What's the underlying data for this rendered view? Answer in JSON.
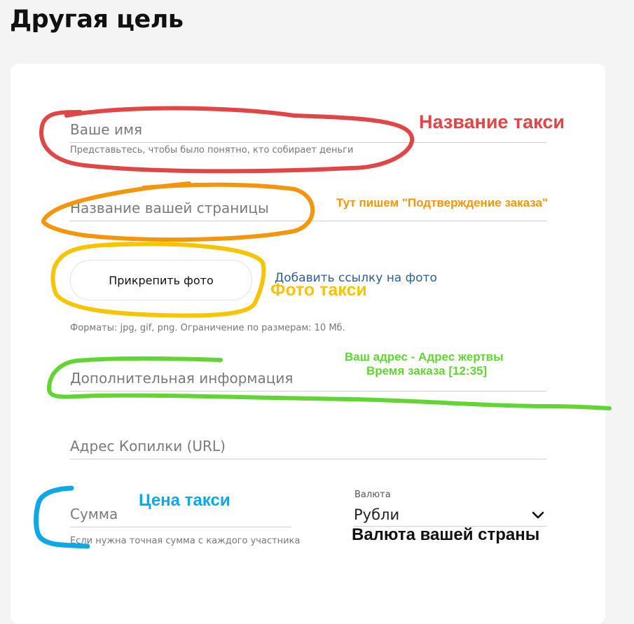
{
  "page": {
    "title": "Другая цель"
  },
  "form": {
    "name": {
      "placeholder": "Ваше имя",
      "hint": "Представьтесь, чтобы было понятно, кто собирает деньги"
    },
    "page_name": {
      "placeholder": "Название вашей страницы"
    },
    "photo": {
      "attach_label": "Прикрепить фото",
      "link_label": "Добавить ссылку на фото",
      "hint": "Форматы: jpg, gif, png. Ограничение по размерам: 10 Мб."
    },
    "extra_info": {
      "placeholder": "Дополнительная информация"
    },
    "piggy_url": {
      "placeholder": "Адрес Копилки (URL)"
    },
    "amount": {
      "placeholder": "Сумма",
      "hint": "Если нужна точная сумма с каждого участника"
    },
    "currency": {
      "label": "Валюта",
      "value": "Рубли",
      "icon": "chevron-down-icon"
    }
  },
  "annotations": {
    "taxi_name": {
      "text": "Название такси",
      "color": "#e04646"
    },
    "page_name_note": {
      "text": "Тут пишем \"Подтверждение заказа\"",
      "color": "#f5950a"
    },
    "photo_note": {
      "text": "Фото такси",
      "color": "#f7c400"
    },
    "address_note": {
      "line1": "Ваш адрес - Адрес жертвы",
      "line2": "Время заказа [12:35]",
      "color": "#62d534"
    },
    "price_note": {
      "text": "Цена такси",
      "color": "#0fa7e6"
    },
    "currency_note": {
      "text": "Валюта вашей страны",
      "color": "#111111"
    }
  }
}
